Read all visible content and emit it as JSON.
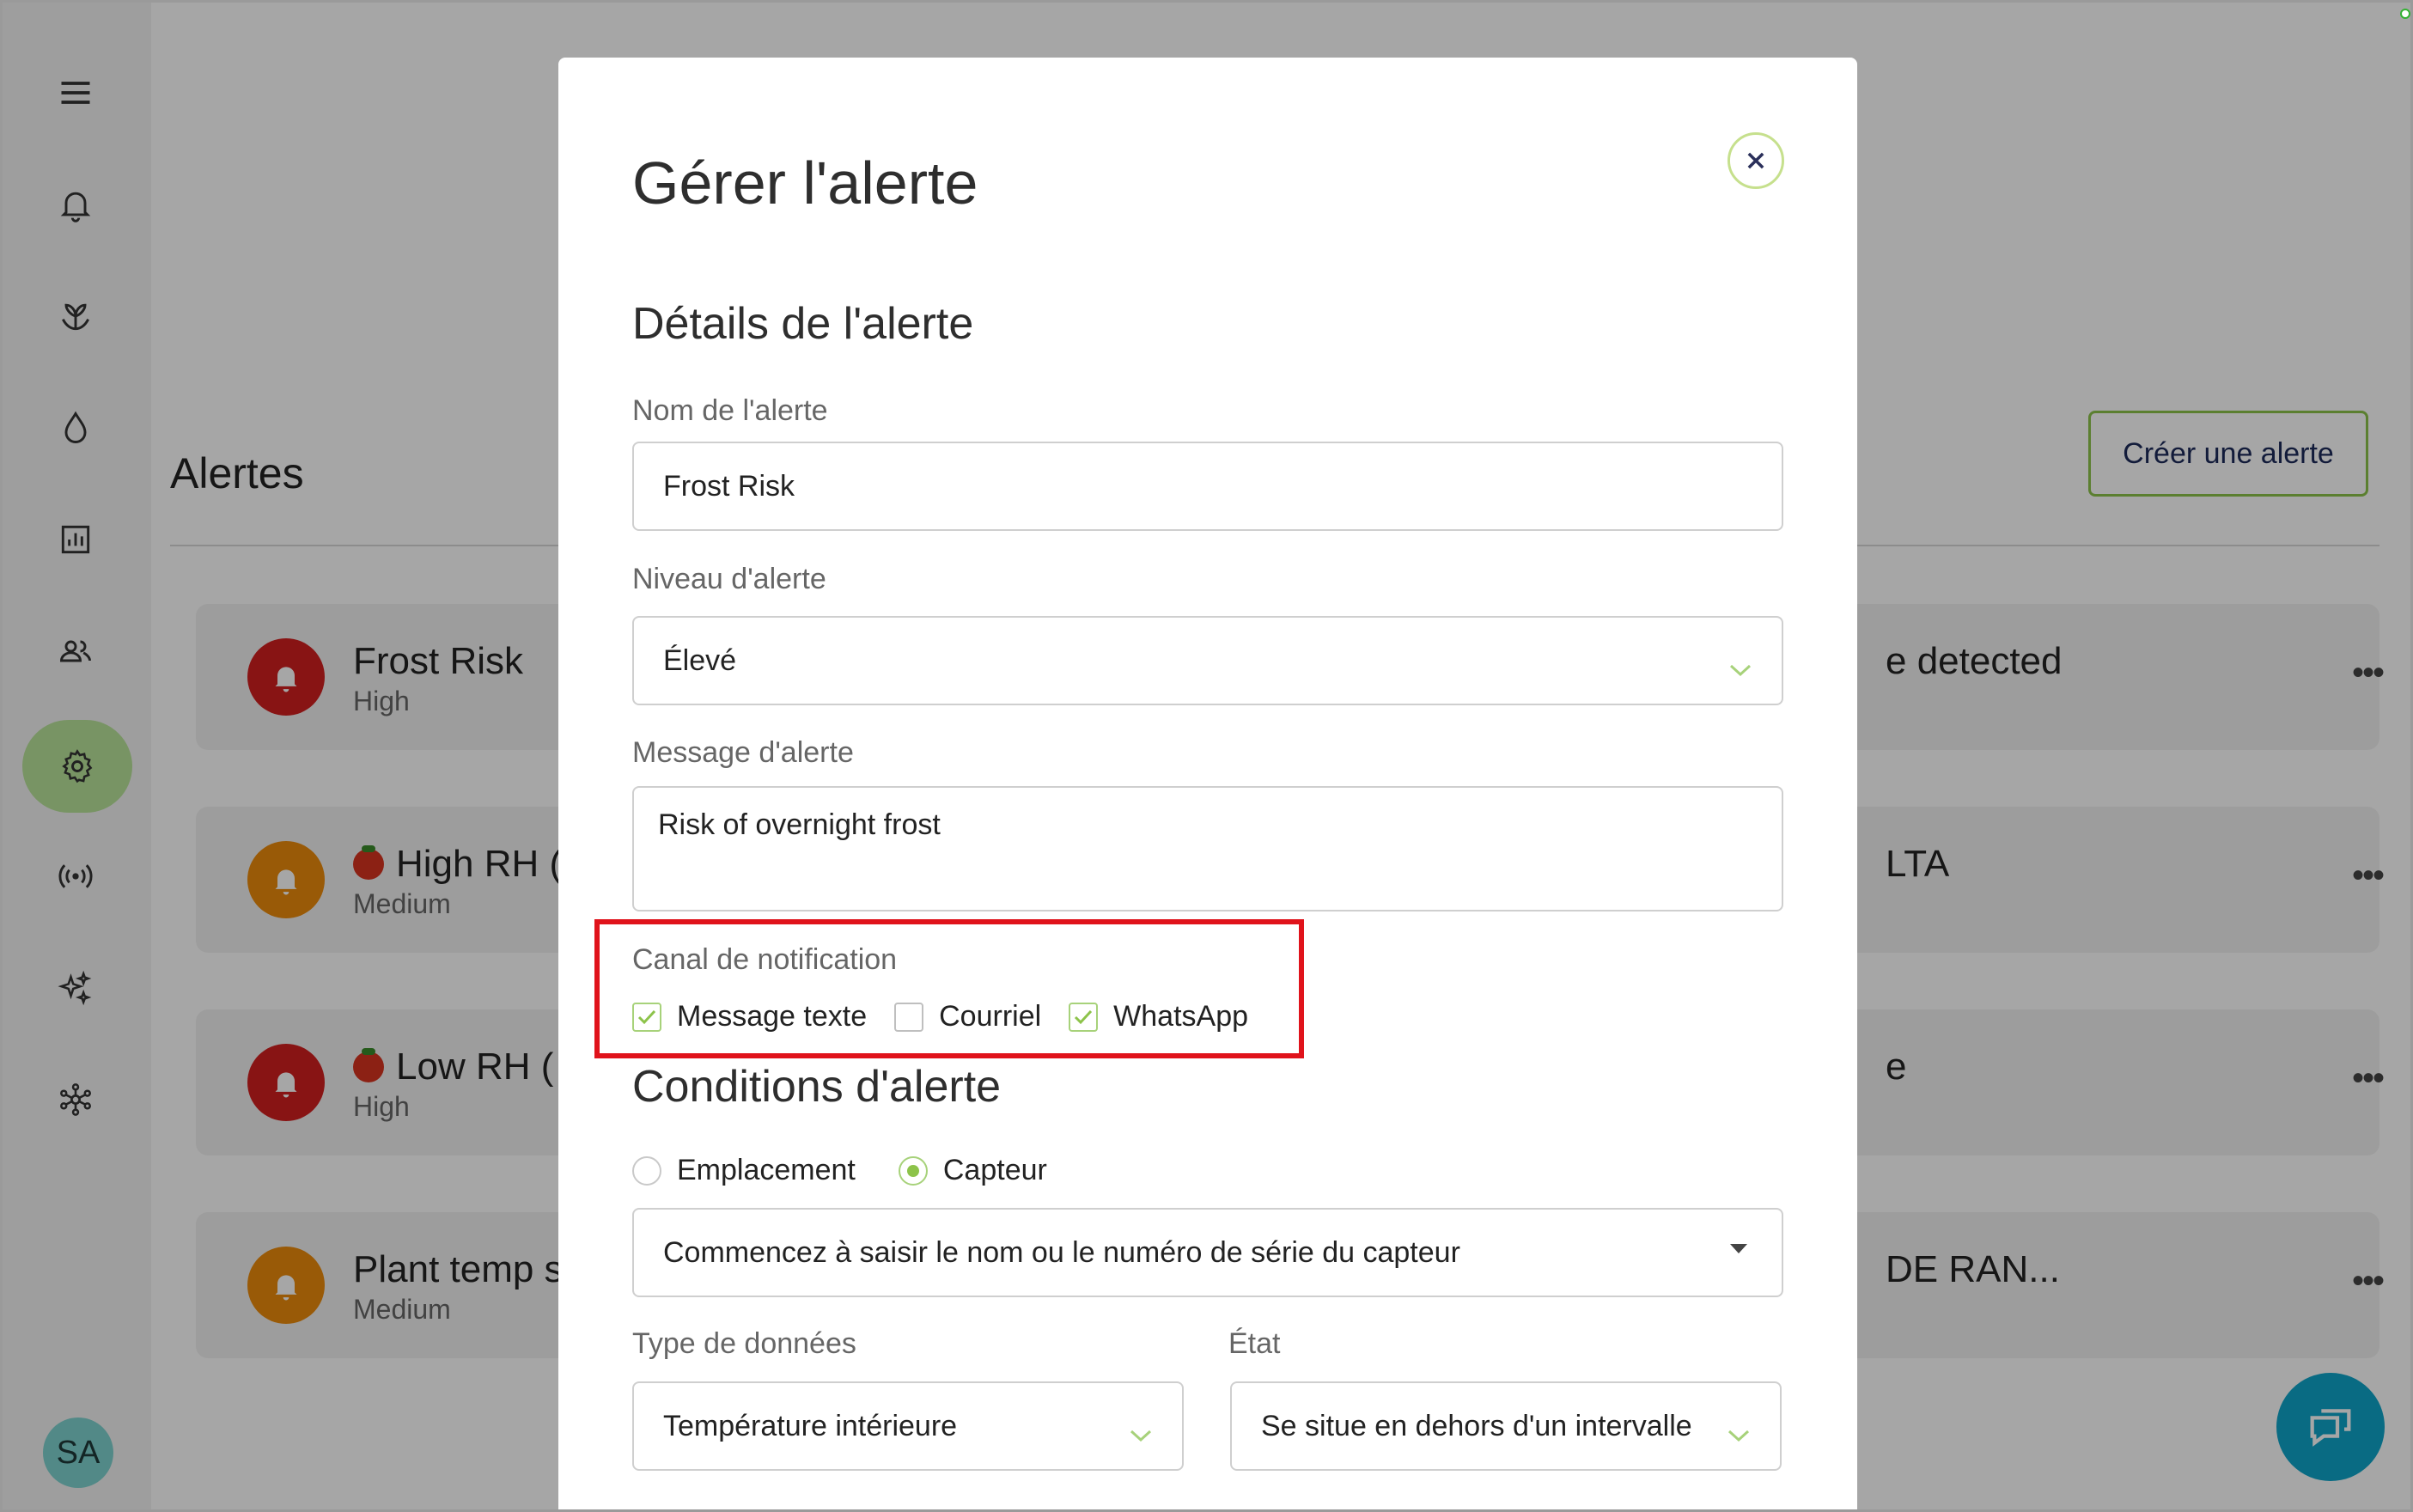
{
  "sidebar": {
    "items": [
      {
        "icon": "menu-icon"
      },
      {
        "icon": "bell-icon"
      },
      {
        "icon": "plant-icon"
      },
      {
        "icon": "water-drop-icon"
      },
      {
        "icon": "bar-chart-icon"
      },
      {
        "icon": "users-icon"
      },
      {
        "icon": "gear-icon",
        "active": true
      },
      {
        "icon": "broadcast-icon"
      },
      {
        "icon": "sparkles-icon"
      },
      {
        "icon": "network-icon"
      }
    ],
    "avatar_initials": "SA",
    "active_color": "#b9e39a"
  },
  "page": {
    "title": "Alertes",
    "create_button": "Créer une alerte",
    "alerts": [
      {
        "name": "Frost Risk",
        "level": "High",
        "severity": "high",
        "right_text": "e detected",
        "has_emoji": false
      },
      {
        "name": "High RH (",
        "level": "Medium",
        "severity": "medium",
        "right_text": "LTA",
        "has_emoji": true
      },
      {
        "name": "Low RH (",
        "level": "High",
        "severity": "high",
        "right_text": "e",
        "has_emoji": true
      },
      {
        "name": "Plant temp s",
        "level": "Medium",
        "severity": "medium",
        "right_text": "DE RAN...",
        "has_emoji": false
      }
    ],
    "more_label": "•••"
  },
  "modal": {
    "title": "Gérer l'alerte",
    "details_title": "Détails de l'alerte",
    "name_label": "Nom de l'alerte",
    "name_value": "Frost Risk",
    "level_label": "Niveau d'alerte",
    "level_value": "Élevé",
    "message_label": "Message d'alerte",
    "message_value": "Risk of overnight frost",
    "channel_label": "Canal de notification",
    "channels": [
      {
        "label": "Message texte",
        "checked": true
      },
      {
        "label": "Courriel",
        "checked": false
      },
      {
        "label": "WhatsApp",
        "checked": true
      }
    ],
    "conditions_title": "Conditions d'alerte",
    "target_options": [
      {
        "label": "Emplacement",
        "checked": false
      },
      {
        "label": "Capteur",
        "checked": true
      }
    ],
    "sensor_placeholder": "Commencez à saisir le nom ou le numéro de série du capteur",
    "data_type_label": "Type de données",
    "data_type_value": "Température intérieure",
    "state_label": "État",
    "state_value": "Se situe en dehors d'un intervalle"
  },
  "colors": {
    "accent_green": "#8dc34a",
    "high": "#d11f1f",
    "medium": "#ec8a0c",
    "chat": "#0ea5c9",
    "highlight_box": "#e0131b"
  }
}
